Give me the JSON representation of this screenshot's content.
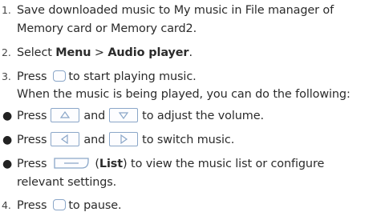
{
  "steps": {
    "s1": {
      "number": "1.",
      "line1": "Save downloaded music to My music in File manager of",
      "line2": "Memory card or Memory card2."
    },
    "s2": {
      "number": "2.",
      "prefix": "Select ",
      "menu": "Menu",
      "sep": " > ",
      "item": "Audio player",
      "suffix": "."
    },
    "s3": {
      "number": "3.",
      "press": "Press",
      "after": "to start playing music.",
      "line2": "When the music is being played, you can do the following:"
    },
    "bullets": {
      "b1": {
        "press": "Press",
        "and": "and",
        "after": "to adjust the volume."
      },
      "b2": {
        "press": "Press",
        "and": "and",
        "after": "to switch music."
      },
      "b3": {
        "press": "Press",
        "open": "(",
        "list": "List",
        "close": ")",
        "after": " to view the music list or configure",
        "line2": "relevant settings."
      }
    },
    "s4": {
      "number": "4.",
      "press": "Press",
      "after": "to pause."
    }
  },
  "icons": {
    "ok_key": "center-key-icon",
    "up_key": "up-arrow-key-icon",
    "down_key": "down-arrow-key-icon",
    "left_key": "left-arrow-key-icon",
    "right_key": "right-arrow-key-icon",
    "soft_key": "soft-key-icon"
  },
  "colors": {
    "key_border": "#8aa6c8",
    "text": "#2b2b2b"
  }
}
